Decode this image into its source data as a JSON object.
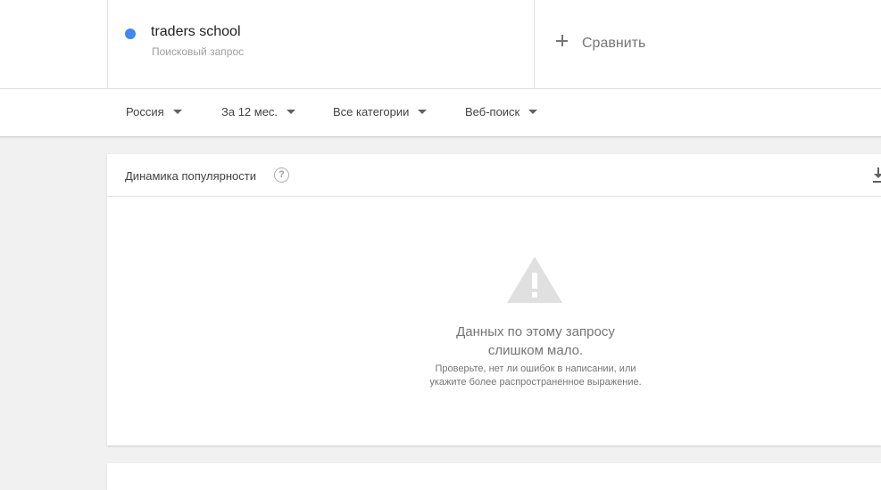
{
  "search_term": {
    "name": "traders school",
    "type_label": "Поисковый запрос",
    "color": "#4285f4"
  },
  "compare": {
    "label": "Сравнить",
    "icon": "plus-icon"
  },
  "filters": [
    {
      "label": "Россия"
    },
    {
      "label": "За 12 мес."
    },
    {
      "label": "Все категории"
    },
    {
      "label": "Веб-поиск"
    }
  ],
  "interest_card": {
    "title": "Динамика популярности",
    "help_icon": "question-circle-icon",
    "download_icon": "download-icon",
    "empty_state": {
      "icon": "warning-triangle-icon",
      "title_line1": "Данных по этому запросу",
      "title_line2": "слишком мало.",
      "subtitle_line1": "Проверьте, нет ли ошибок в написании, или",
      "subtitle_line2": "укажите более распространенное выражение."
    }
  }
}
